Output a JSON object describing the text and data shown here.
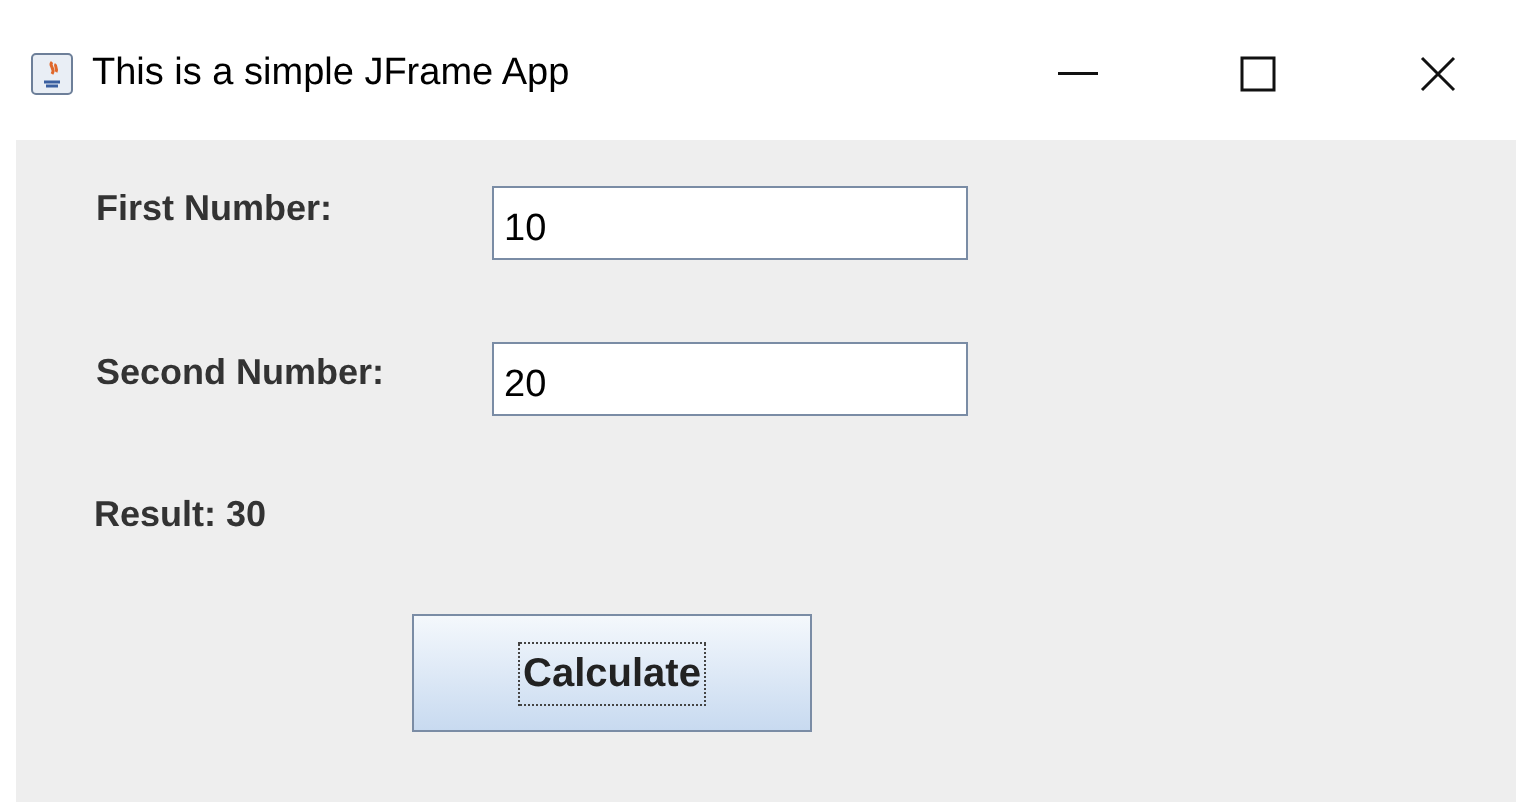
{
  "window": {
    "title": "This is a simple JFrame App"
  },
  "fields": [
    {
      "label": "First Number:",
      "value": "10"
    },
    {
      "label": "Second Number:",
      "value": "20"
    }
  ],
  "result": "Result: 30",
  "button": {
    "label": "Calculate",
    "focused": true
  }
}
